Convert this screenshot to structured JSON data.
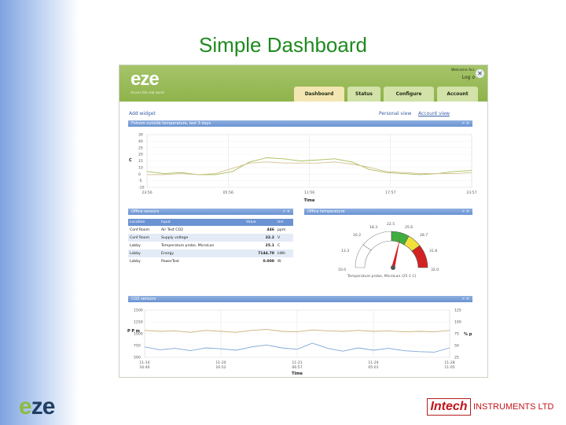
{
  "slide": {
    "title": "Simple Dashboard"
  },
  "app": {
    "logo": {
      "e1": "e",
      "rest": "ze"
    },
    "tagline": "Access the real world",
    "welcome": "Welcome Acc",
    "logout": "Log o",
    "close_icon": "close-icon",
    "tabs": [
      {
        "label": "Dashboard",
        "active": true
      },
      {
        "label": "Status",
        "active": false
      },
      {
        "label": "Configure",
        "active": false
      },
      {
        "label": "Account",
        "active": false
      }
    ],
    "add_widget": "Add widget",
    "personal_view": "Personal view",
    "account_view": "Account view",
    "panel_controls": "↗ ×"
  },
  "panels": {
    "temp_chart": {
      "title": "Folsom outside temperature, last 3 days",
      "ylabel": "C",
      "xlabel": "Time",
      "y_ticks": [
        "30",
        "40",
        "25",
        "20",
        "15",
        "10",
        "0",
        "-5",
        "-10"
      ],
      "x_ticks": [
        "23:56",
        "05:56",
        "11:56",
        "17:57",
        "23:57"
      ]
    },
    "sensors": {
      "title": "Office sensors",
      "columns": [
        "Location",
        "Input",
        "Value",
        "Uni"
      ],
      "rows": [
        [
          "Conf Room",
          "Air Test CO2",
          "446",
          "ppm"
        ],
        [
          "Conf Room",
          "Supply voltage",
          "32.2",
          "V"
        ],
        [
          "Lobby",
          "Temperature probe, MicroLan",
          "25.1",
          "C"
        ],
        [
          "Lobby",
          "Energy",
          "7144.70",
          "kWh"
        ],
        [
          "Lobby",
          "PowerTest",
          "0.000",
          "W"
        ]
      ]
    },
    "gauge": {
      "title": "Office temperature",
      "labels": [
        "10.0",
        "13.3",
        "16.2",
        "18.3",
        "22.5",
        "25.6",
        "28.7",
        "31.8",
        "32.0"
      ],
      "caption": "Temperature probe, MicroLan (25.1 C)"
    },
    "co2": {
      "title": "CO2 sensors",
      "ylabel_left": "P P m",
      "ylabel_right": "% p",
      "left_ticks": [
        "1500",
        "1250",
        "1000",
        "750",
        "500"
      ],
      "right_ticks": [
        "125",
        "100",
        "75",
        "50",
        "25"
      ],
      "x_ticks": [
        [
          "11-14",
          "16:46"
        ],
        [
          "11-20",
          "16:52"
        ],
        [
          "11-21",
          "06:57"
        ],
        [
          "11-24",
          "05:01"
        ],
        [
          "11-28",
          "11:05"
        ]
      ],
      "xlabel": "Time"
    }
  },
  "chart_data": [
    {
      "type": "line",
      "title": "Folsom outside temperature, last 3 days",
      "xlabel": "Time",
      "ylabel": "C",
      "x": [
        "23:56",
        "05:56",
        "11:56",
        "17:57",
        "23:57"
      ],
      "series": [
        {
          "values": [
            5,
            3,
            4,
            2,
            2,
            5,
            14,
            18,
            17,
            15,
            16,
            17,
            14,
            7,
            4,
            3,
            2,
            3,
            5,
            6
          ]
        },
        {
          "values": [
            2,
            2,
            3,
            2,
            3,
            8,
            13,
            14,
            13,
            13,
            13,
            14,
            12,
            9,
            5,
            4,
            3,
            3,
            3,
            4
          ]
        }
      ],
      "colors": [
        "#a8bf5a",
        "#d3c190"
      ]
    },
    {
      "type": "line",
      "title": "CO2 sensors",
      "xlabel": "Time",
      "ylim_left": [
        500,
        1500
      ],
      "ylim_right": [
        25,
        125
      ],
      "series": [
        {
          "axis": "left",
          "values": [
            720,
            660,
            690,
            640,
            700,
            680,
            650,
            720,
            760,
            700,
            670,
            800,
            690,
            630,
            700,
            650,
            690,
            640,
            620,
            610,
            700
          ]
        },
        {
          "axis": "right",
          "values": [
            82,
            80,
            81,
            78,
            82,
            80,
            78,
            82,
            84,
            80,
            79,
            83,
            81,
            80,
            82,
            80,
            81,
            79,
            80,
            79,
            82
          ]
        }
      ],
      "colors": [
        "#7fa6d9",
        "#c9b27a"
      ]
    }
  ],
  "brand": {
    "eze_e1": "e",
    "eze_rest": "ze",
    "intech_box": "Intech",
    "intech_rest": "INSTRUMENTS LTD"
  }
}
